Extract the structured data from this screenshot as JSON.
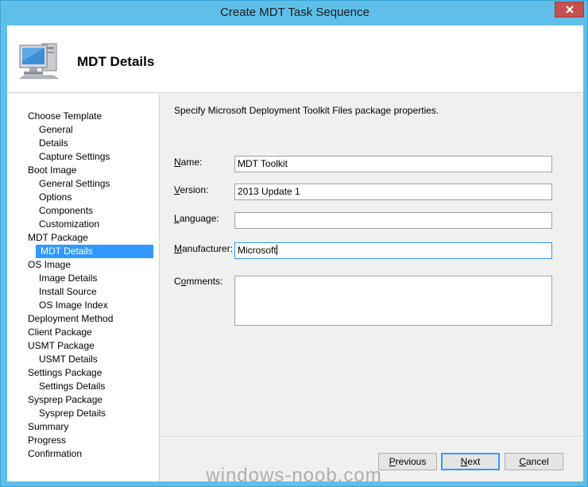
{
  "window": {
    "title": "Create MDT Task Sequence"
  },
  "header": {
    "title": "MDT Details",
    "icon": "computer-icon"
  },
  "nav": {
    "items": [
      {
        "label": "Choose Template",
        "level": 0,
        "selected": false
      },
      {
        "label": "General",
        "level": 1,
        "selected": false
      },
      {
        "label": "Details",
        "level": 1,
        "selected": false
      },
      {
        "label": "Capture Settings",
        "level": 1,
        "selected": false
      },
      {
        "label": "Boot Image",
        "level": 0,
        "selected": false
      },
      {
        "label": "General Settings",
        "level": 1,
        "selected": false
      },
      {
        "label": "Options",
        "level": 1,
        "selected": false
      },
      {
        "label": "Components",
        "level": 1,
        "selected": false
      },
      {
        "label": "Customization",
        "level": 1,
        "selected": false
      },
      {
        "label": "MDT Package",
        "level": 0,
        "selected": false
      },
      {
        "label": "MDT Details",
        "level": 1,
        "selected": true
      },
      {
        "label": "OS Image",
        "level": 0,
        "selected": false
      },
      {
        "label": "Image Details",
        "level": 1,
        "selected": false
      },
      {
        "label": "Install Source",
        "level": 1,
        "selected": false
      },
      {
        "label": "OS Image Index",
        "level": 1,
        "selected": false
      },
      {
        "label": "Deployment Method",
        "level": 0,
        "selected": false
      },
      {
        "label": "Client Package",
        "level": 0,
        "selected": false
      },
      {
        "label": "USMT Package",
        "level": 0,
        "selected": false
      },
      {
        "label": "USMT Details",
        "level": 1,
        "selected": false
      },
      {
        "label": "Settings Package",
        "level": 0,
        "selected": false
      },
      {
        "label": "Settings Details",
        "level": 1,
        "selected": false
      },
      {
        "label": "Sysprep Package",
        "level": 0,
        "selected": false
      },
      {
        "label": "Sysprep Details",
        "level": 1,
        "selected": false
      },
      {
        "label": "Summary",
        "level": 0,
        "selected": false
      },
      {
        "label": "Progress",
        "level": 0,
        "selected": false
      },
      {
        "label": "Confirmation",
        "level": 0,
        "selected": false
      }
    ]
  },
  "form": {
    "description": "Specify Microsoft Deployment Toolkit Files package properties.",
    "name": {
      "label_pre": "",
      "label_key": "N",
      "label_post": "ame:",
      "value": "MDT Toolkit"
    },
    "version": {
      "label_pre": "",
      "label_key": "V",
      "label_post": "ersion:",
      "value": "2013 Update 1"
    },
    "language": {
      "label_pre": "",
      "label_key": "L",
      "label_post": "anguage:",
      "value": ""
    },
    "manufacturer": {
      "label_pre": "",
      "label_key": "M",
      "label_post": "anufacturer:",
      "value": "Microsoft"
    },
    "comments": {
      "label_pre": "C",
      "label_key": "o",
      "label_post": "mments:",
      "value": ""
    }
  },
  "buttons": {
    "previous": {
      "key": "P",
      "rest": "revious"
    },
    "next": {
      "key": "N",
      "rest": "ext"
    },
    "cancel": {
      "key": "C",
      "rest": "ancel"
    }
  },
  "watermark": "windows-noob.com",
  "colors": {
    "titlebar": "#5fbfe8",
    "selection": "#3399ff",
    "close": "#c7504f"
  }
}
